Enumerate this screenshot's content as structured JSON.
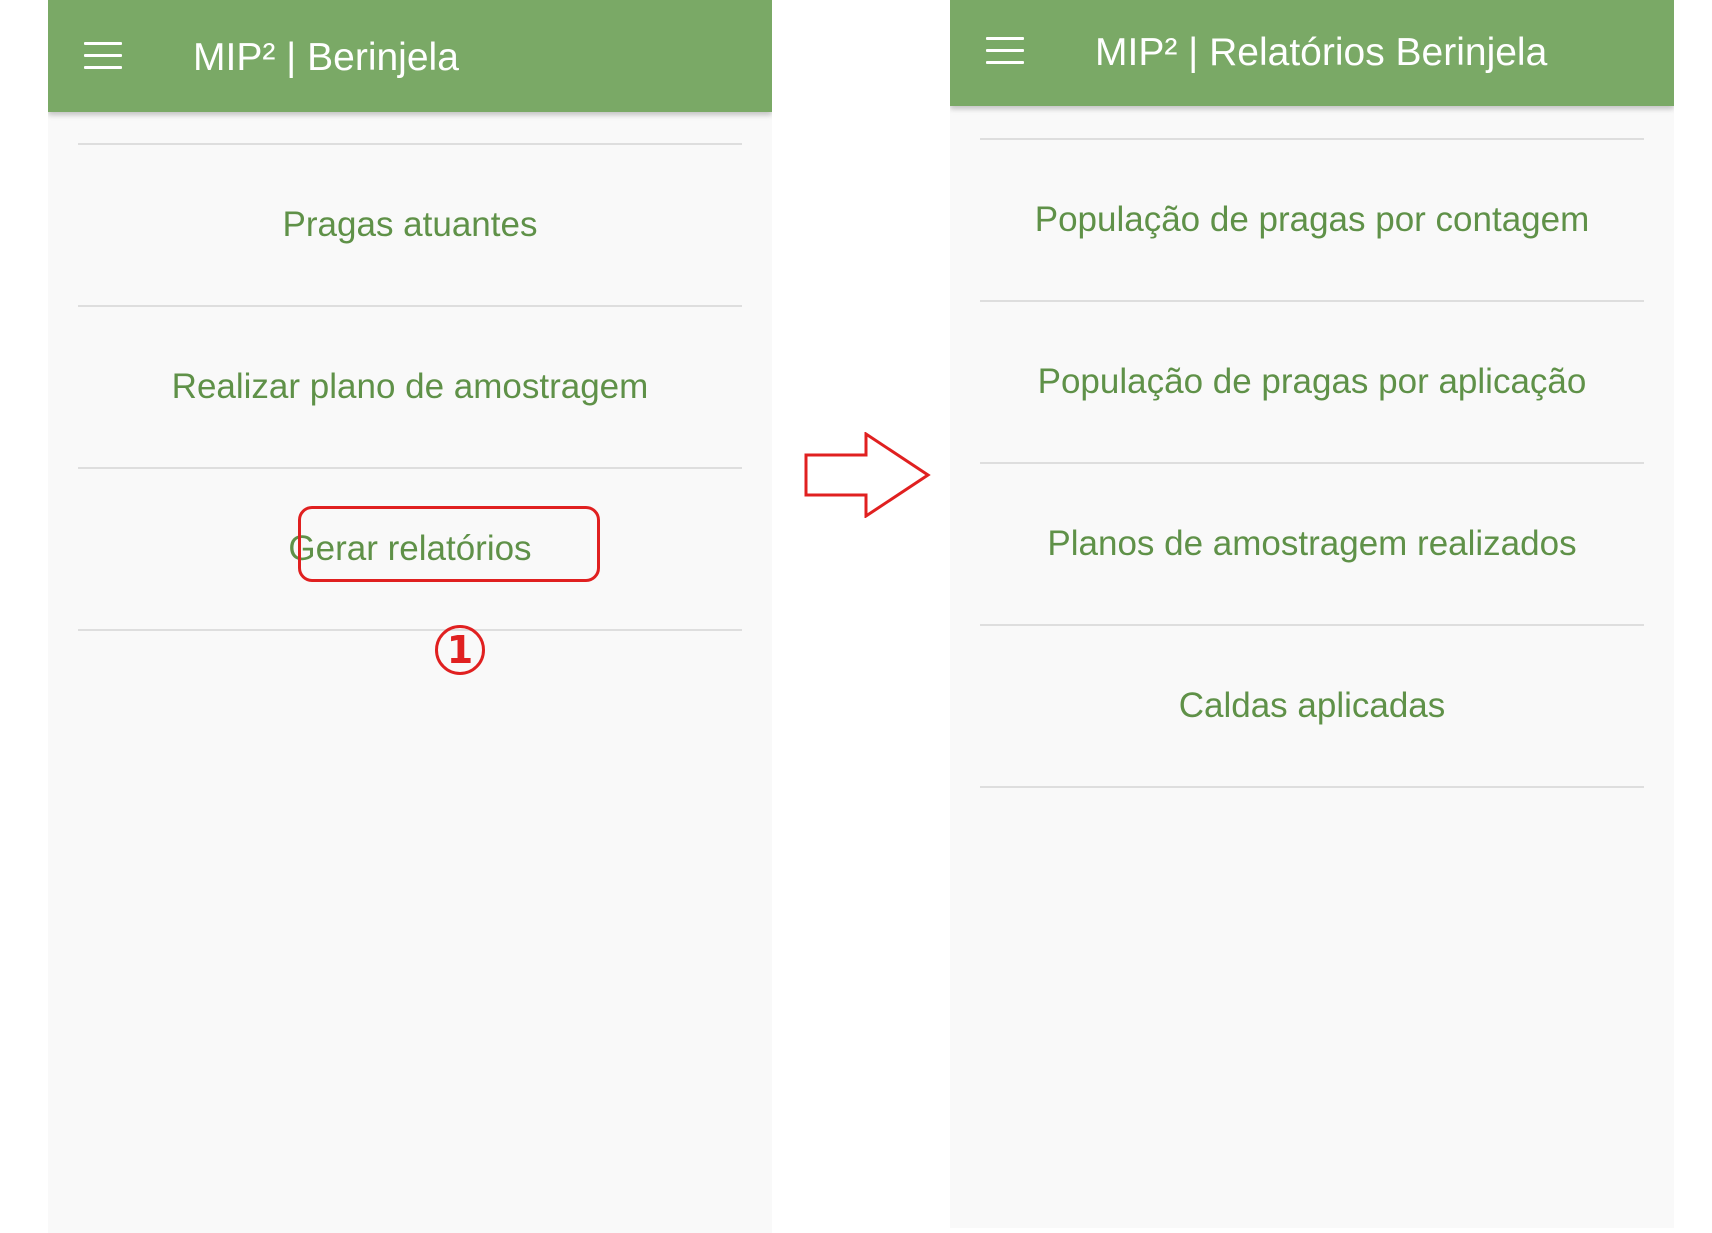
{
  "left_screen": {
    "appbar": {
      "title": "MIP² | Berinjela",
      "menu_icon": "hamburger-menu-icon"
    },
    "menu_items": [
      {
        "label": "Pragas atuantes"
      },
      {
        "label": "Realizar plano de amostragem"
      },
      {
        "label": "Gerar relatórios"
      }
    ]
  },
  "annotation": {
    "step_number": "1",
    "highlighted_item": "Gerar relatórios",
    "color": "#e02020",
    "arrow_icon": "right-arrow-icon"
  },
  "right_screen": {
    "appbar": {
      "title": "MIP² | Relatórios Berinjela",
      "menu_icon": "hamburger-menu-icon"
    },
    "menu_items": [
      {
        "label": "População de pragas por contagem"
      },
      {
        "label": "População de pragas por aplicação"
      },
      {
        "label": "Planos de amostragem realizados"
      },
      {
        "label": "Caldas aplicadas"
      }
    ]
  },
  "colors": {
    "appbar": "#7aa966",
    "item_text": "#5f9148",
    "background": "#f9f9f9",
    "divider": "#dedede"
  }
}
